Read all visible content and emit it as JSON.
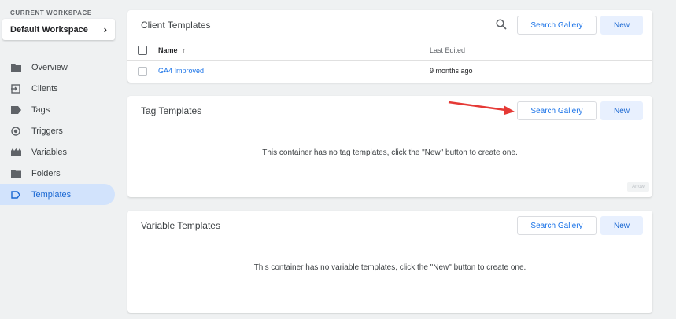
{
  "sidebar": {
    "workspace_label": "CURRENT WORKSPACE",
    "workspace_name": "Default Workspace",
    "items": [
      {
        "label": "Overview",
        "icon": "folder-icon"
      },
      {
        "label": "Clients",
        "icon": "login-icon"
      },
      {
        "label": "Tags",
        "icon": "tag-icon"
      },
      {
        "label": "Triggers",
        "icon": "trigger-icon"
      },
      {
        "label": "Variables",
        "icon": "variables-icon"
      },
      {
        "label": "Folders",
        "icon": "folder-icon"
      },
      {
        "label": "Templates",
        "icon": "template-icon",
        "active": true
      }
    ]
  },
  "client_templates": {
    "title": "Client Templates",
    "search_gallery": "Search Gallery",
    "new": "New",
    "columns": {
      "name": "Name",
      "last_edited": "Last Edited"
    },
    "rows": [
      {
        "name": "GA4 Improved",
        "last_edited": "9 months ago"
      }
    ]
  },
  "tag_templates": {
    "title": "Tag Templates",
    "search_gallery": "Search Gallery",
    "new": "New",
    "empty": "This container has no tag templates, click the \"New\" button to create one.",
    "tiny_button": "Arrow"
  },
  "variable_templates": {
    "title": "Variable Templates",
    "search_gallery": "Search Gallery",
    "new": "New",
    "empty": "This container has no variable templates, click the \"New\" button to create one."
  },
  "colors": {
    "accent": "#1a73e8",
    "active_bg": "#d2e3fc",
    "arrow": "#e53935"
  }
}
